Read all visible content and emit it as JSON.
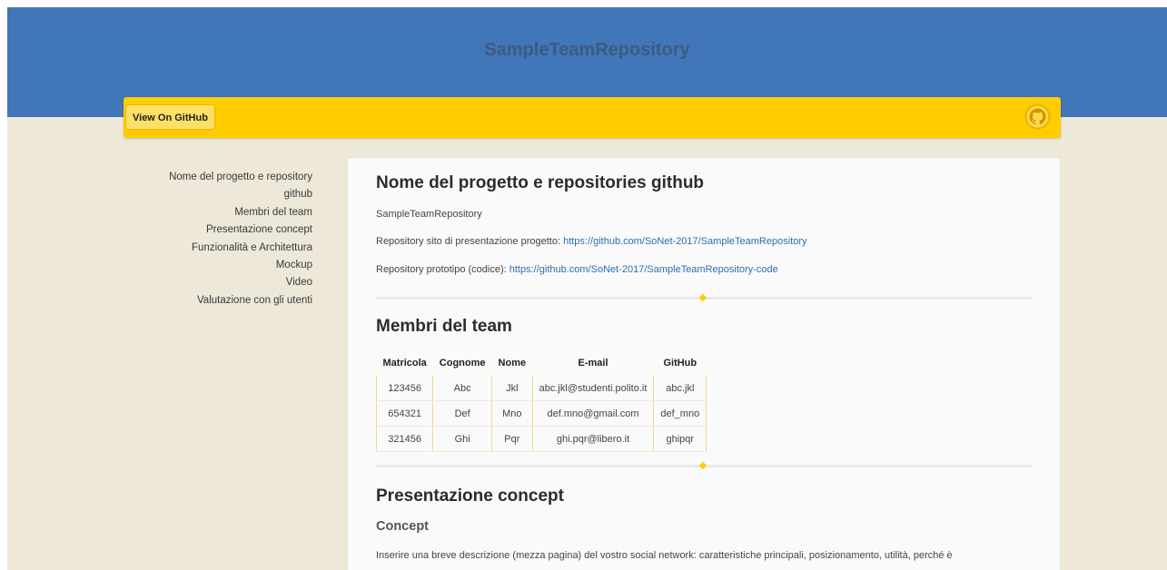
{
  "header": {
    "title": "SampleTeamRepository",
    "github_button_label": "View On GitHub",
    "github_icon": "github-octocat-icon"
  },
  "toc": {
    "items": [
      "Nome del progetto e repository github",
      "Membri del team",
      "Presentazione concept",
      "Funzionalità e Architettura",
      "Mockup",
      "Video",
      "Valutazione con gli utenti"
    ]
  },
  "sections": {
    "project": {
      "heading": "Nome del progetto e repositories github",
      "name": "SampleTeamRepository",
      "site_repo_label": "Repository sito di presentazione progetto:",
      "site_repo_link": "https://github.com/SoNet-2017/SampleTeamRepository",
      "code_repo_label": "Repository prototipo (codice):",
      "code_repo_link": "https://github.com/SoNet-2017/SampleTeamRepository-code"
    },
    "team": {
      "heading": "Membri del team",
      "columns": [
        "Matricola",
        "Cognome",
        "Nome",
        "E-mail",
        "GitHub"
      ],
      "rows": [
        [
          "123456",
          "Abc",
          "Jkl",
          "abc.jkl@studenti.polito.it",
          "abc.jkl"
        ],
        [
          "654321",
          "Def",
          "Mno",
          "def.mno@gmail.com",
          "def_mno"
        ],
        [
          "321456",
          "Ghi",
          "Pqr",
          "ghi.pqr@libero.it",
          "ghipqr"
        ]
      ]
    },
    "concept": {
      "heading": "Presentazione concept",
      "subheading": "Concept",
      "text": "Inserire una breve descrizione (mezza pagina) del vostro social network: caratteristiche principali, posizionamento, utilità, perché è"
    }
  },
  "colors": {
    "header_bg": "#4176b8",
    "ribbon": "#ffcc00",
    "page_bg": "#ede8d8",
    "link": "#2d6eb0"
  }
}
